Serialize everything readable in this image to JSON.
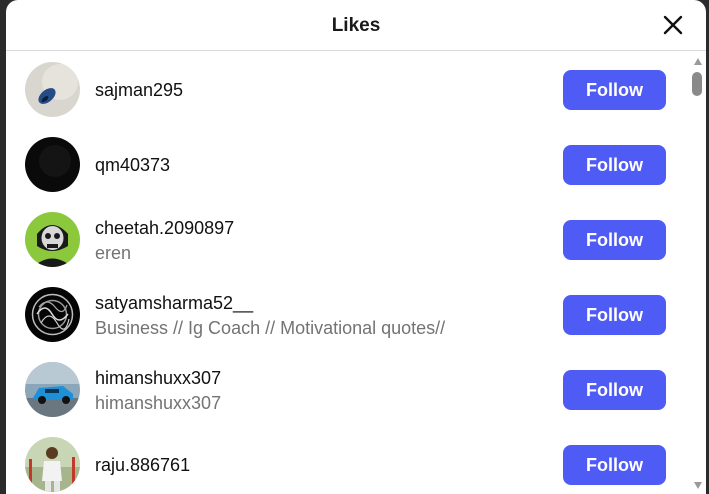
{
  "dialog": {
    "title": "Likes",
    "close_icon": "close-icon"
  },
  "colors": {
    "accent": "#4f5bf5",
    "secondary_text": "#737373",
    "divider": "#dbdbdb"
  },
  "users": [
    {
      "username": "sajman295",
      "subtitle": "",
      "button": "Follow"
    },
    {
      "username": "qm40373",
      "subtitle": "",
      "button": "Follow"
    },
    {
      "username": "cheetah.2090897",
      "subtitle": "eren",
      "button": "Follow"
    },
    {
      "username": "satyamsharma52__",
      "subtitle": "Business // Ig Coach // Motivational quotes//",
      "button": "Follow"
    },
    {
      "username": "himanshuxx307",
      "subtitle": "himanshuxx307",
      "button": "Follow"
    },
    {
      "username": "raju.886761",
      "subtitle": "",
      "button": "Follow"
    }
  ]
}
